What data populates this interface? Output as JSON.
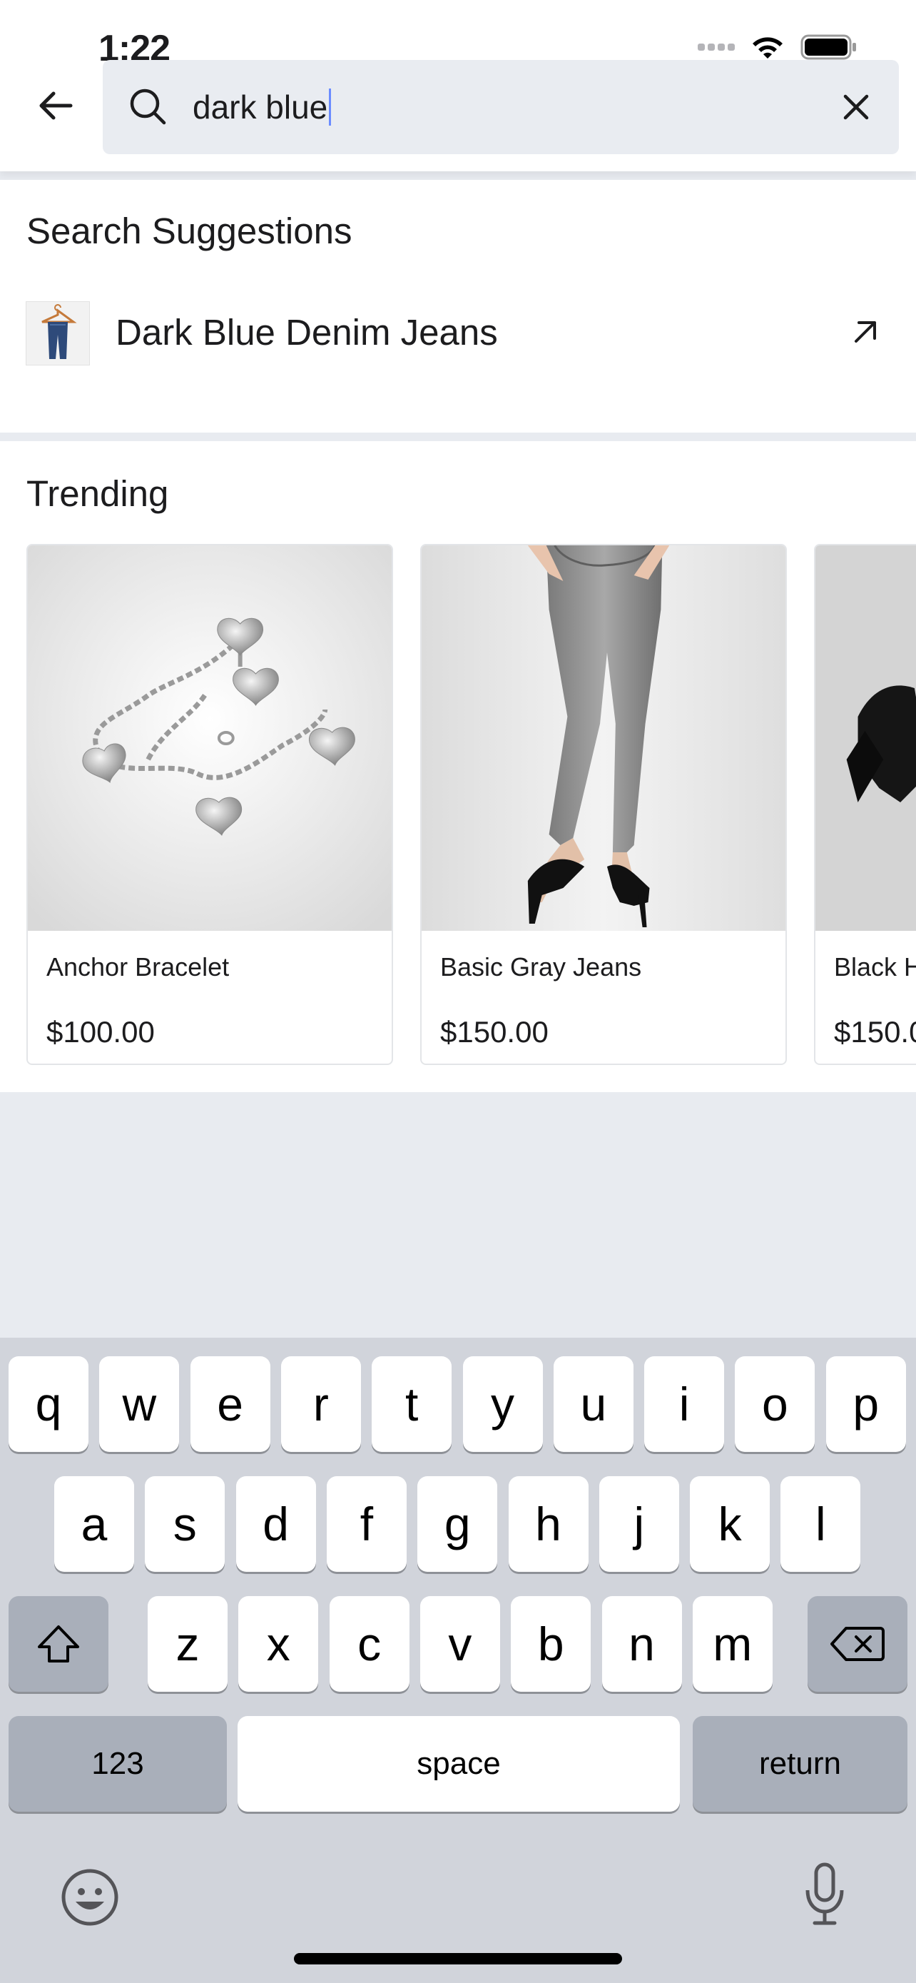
{
  "status_bar": {
    "time": "1:22",
    "icons": [
      "signal-icon",
      "wifi-icon",
      "battery-icon"
    ]
  },
  "header": {
    "back_icon": "back-arrow-icon",
    "search": {
      "icon": "search-icon",
      "value": "dark blue",
      "clear_icon": "close-icon"
    }
  },
  "suggestions": {
    "title": "Search Suggestions",
    "items": [
      {
        "label": "Dark Blue Denim Jeans",
        "thumb": "jeans-on-hanger-thumbnail",
        "action_icon": "arrow-up-left-icon"
      }
    ]
  },
  "trending": {
    "title": "Trending",
    "products": [
      {
        "name": "Anchor Bracelet",
        "price": "$100.00",
        "image": "silver-heart-charm-bracelet"
      },
      {
        "name": "Basic Gray Jeans",
        "price": "$150.00",
        "image": "gray-skinny-jeans-model"
      },
      {
        "name": "Black H",
        "price": "$150.0",
        "image": "black-jacket-partial"
      }
    ]
  },
  "keyboard": {
    "row1": [
      "q",
      "w",
      "e",
      "r",
      "t",
      "y",
      "u",
      "i",
      "o",
      "p"
    ],
    "row2": [
      "a",
      "s",
      "d",
      "f",
      "g",
      "h",
      "j",
      "k",
      "l"
    ],
    "row3": [
      "z",
      "x",
      "c",
      "v",
      "b",
      "n",
      "m"
    ],
    "shift_icon": "shift-icon",
    "delete_icon": "backspace-icon",
    "numbers_label": "123",
    "space_label": "space",
    "return_label": "return",
    "emoji_icon": "emoji-icon",
    "mic_icon": "microphone-icon"
  },
  "colors": {
    "page_background": "#e8ebf0",
    "search_field": "#e9ecf1",
    "caret": "#6b8cff",
    "keyboard_background": "#d1d4db",
    "key_dark": "#a9afba"
  }
}
